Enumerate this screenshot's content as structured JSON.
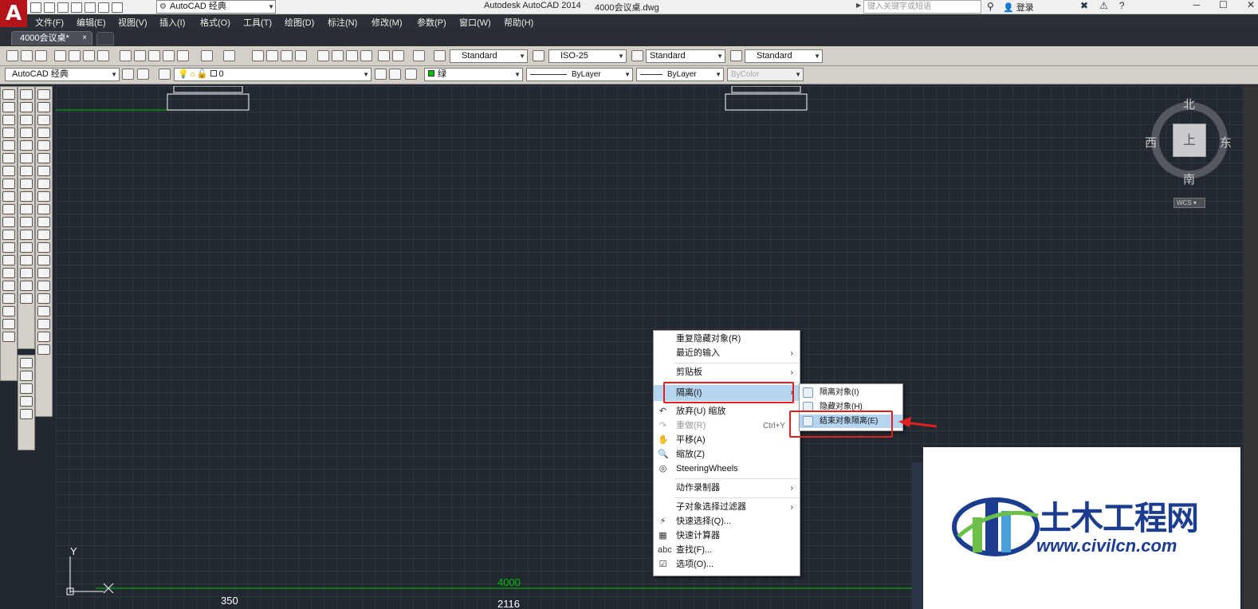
{
  "app": {
    "title": "Autodesk AutoCAD 2014",
    "file": "4000会议桌.dwg",
    "workspace": "AutoCAD 经典",
    "search_placeholder": "键入关键字或短语",
    "login": "登录",
    "logo_letter": "A"
  },
  "menubar": [
    "文件(F)",
    "编辑(E)",
    "视图(V)",
    "插入(I)",
    "格式(O)",
    "工具(T)",
    "绘图(D)",
    "标注(N)",
    "修改(M)",
    "参数(P)",
    "窗口(W)",
    "帮助(H)"
  ],
  "tabs": {
    "active": "4000会议桌*",
    "close": "×"
  },
  "styles": {
    "text_style": "Standard",
    "dim_style": "ISO-25",
    "table_style": "Standard",
    "multileader_style": "Standard"
  },
  "layers": {
    "workspace": "AutoCAD 经典",
    "current_layer": "0",
    "color": "绿",
    "linetype": "ByLayer",
    "lineweight": "ByLayer",
    "plotstyle": "ByColor"
  },
  "viewcube": {
    "north": "北",
    "south": "南",
    "east": "东",
    "west": "西",
    "face": "上",
    "wcs": "WCS"
  },
  "ucs": {
    "x": "X",
    "y": "Y"
  },
  "dimensions": {
    "overall": "4000",
    "left": "350",
    "mid": "2116"
  },
  "context_menu": {
    "items": [
      {
        "label": "重复隐藏对象(R)"
      },
      {
        "label": "最近的输入",
        "sub": true
      },
      {
        "label": "剪贴板",
        "sub": true
      },
      {
        "label": "隔离(I)",
        "sub": true,
        "highlight": true
      },
      {
        "label": "放弃(U) 缩放"
      },
      {
        "label": "重做(R)",
        "shortcut": "Ctrl+Y",
        "disabled": true
      },
      {
        "label": "平移(A)"
      },
      {
        "label": "缩放(Z)"
      },
      {
        "label": "SteeringWheels"
      },
      {
        "label": "动作录制器",
        "sub": true
      },
      {
        "label": "子对象选择过滤器",
        "sub": true
      },
      {
        "label": "快速选择(Q)..."
      },
      {
        "label": "快速计算器"
      },
      {
        "label": "查找(F)..."
      },
      {
        "label": "选项(O)..."
      }
    ]
  },
  "submenu": {
    "items": [
      {
        "label": "隔离对象(I)"
      },
      {
        "label": "隐藏对象(H)"
      },
      {
        "label": "结束对象隔离(E)",
        "highlight": true
      }
    ]
  },
  "watermark": {
    "cn": "土木工程网",
    "url": "www.civilcn.com"
  },
  "colors": {
    "accent_red": "#e02020",
    "layer_green": "#00c000",
    "logo_blue": "#1c3d8f"
  }
}
